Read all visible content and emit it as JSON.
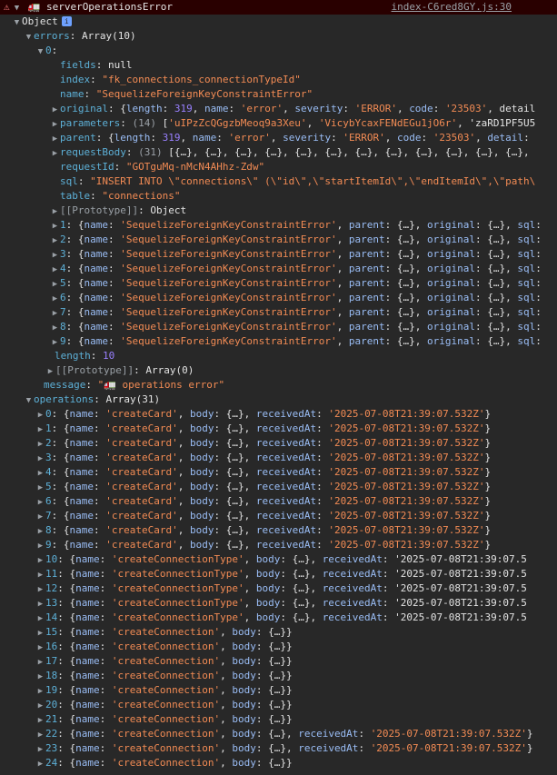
{
  "header": {
    "warn_icon": "⚠",
    "title": "serverOperationsError",
    "link": "index-C6red8GY.js:30"
  },
  "object_label": "Object",
  "errors_label": "errors",
  "errors_type": "Array(10)",
  "error0": {
    "key": "0",
    "fields": {
      "key": "fields",
      "value": "null"
    },
    "index": {
      "key": "index",
      "value": "\"fk_connections_connectionTypeId\""
    },
    "name": {
      "key": "name",
      "value": "\"SequelizeForeignKeyConstraintError\""
    },
    "original": {
      "key": "original",
      "value": "{length: 319, name: 'error', severity: 'ERROR', code: '23503', detail"
    },
    "parameters": {
      "key": "parameters",
      "value": "(14) ['uIPzZcQGgzbMeoq9a3Xeu', 'VicybYcaxFENdEGu1jO6r', 'zaRD1PF5U5"
    },
    "parent": {
      "key": "parent",
      "value": "{length: 319, name: 'error', severity: 'ERROR', code: '23503', detail:"
    },
    "requestBody": {
      "key": "requestBody",
      "value": "(31) [{…}, {…}, {…}, {…}, {…}, {…}, {…}, {…}, {…}, {…}, {…}, {…},"
    },
    "requestId": {
      "key": "requestId",
      "value": "\"GOTguMq-nMcN4AHhz-Zdw\""
    },
    "sql": {
      "key": "sql",
      "value": "\"INSERT INTO \\\"connections\\\" (\\\"id\\\",\\\"startItemId\\\",\\\"endItemId\\\",\\\"path\\"
    },
    "table": {
      "key": "table",
      "value": "\"connections\""
    },
    "prototype": {
      "key": "[[Prototype]]",
      "value": "Object"
    }
  },
  "error_rows": [
    "{name: 'SequelizeForeignKeyConstraintError', parent: {…}, original: {…}, sql:",
    "{name: 'SequelizeForeignKeyConstraintError', parent: {…}, original: {…}, sql:",
    "{name: 'SequelizeForeignKeyConstraintError', parent: {…}, original: {…}, sql:",
    "{name: 'SequelizeForeignKeyConstraintError', parent: {…}, original: {…}, sql:",
    "{name: 'SequelizeForeignKeyConstraintError', parent: {…}, original: {…}, sql:",
    "{name: 'SequelizeForeignKeyConstraintError', parent: {…}, original: {…}, sql:",
    "{name: 'SequelizeForeignKeyConstraintError', parent: {…}, original: {…}, sql:",
    "{name: 'SequelizeForeignKeyConstraintError', parent: {…}, original: {…}, sql:",
    "{name: 'SequelizeForeignKeyConstraintError', parent: {…}, original: {…}, sql:"
  ],
  "errors_length": {
    "key": "length",
    "value": "10"
  },
  "errors_prototype": {
    "key": "[[Prototype]]",
    "value": "Array(0)"
  },
  "message": {
    "key": "message",
    "value": "\"🚛 operations error\""
  },
  "operations_label": "operations",
  "operations_type": "Array(31)",
  "operations_rows": [
    "{name: 'createCard', body: {…}, receivedAt: '2025-07-08T21:39:07.532Z'}",
    "{name: 'createCard', body: {…}, receivedAt: '2025-07-08T21:39:07.532Z'}",
    "{name: 'createCard', body: {…}, receivedAt: '2025-07-08T21:39:07.532Z'}",
    "{name: 'createCard', body: {…}, receivedAt: '2025-07-08T21:39:07.532Z'}",
    "{name: 'createCard', body: {…}, receivedAt: '2025-07-08T21:39:07.532Z'}",
    "{name: 'createCard', body: {…}, receivedAt: '2025-07-08T21:39:07.532Z'}",
    "{name: 'createCard', body: {…}, receivedAt: '2025-07-08T21:39:07.532Z'}",
    "{name: 'createCard', body: {…}, receivedAt: '2025-07-08T21:39:07.532Z'}",
    "{name: 'createCard', body: {…}, receivedAt: '2025-07-08T21:39:07.532Z'}",
    "{name: 'createCard', body: {…}, receivedAt: '2025-07-08T21:39:07.532Z'}",
    "{name: 'createConnectionType', body: {…}, receivedAt: '2025-07-08T21:39:07.5",
    "{name: 'createConnectionType', body: {…}, receivedAt: '2025-07-08T21:39:07.5",
    "{name: 'createConnectionType', body: {…}, receivedAt: '2025-07-08T21:39:07.5",
    "{name: 'createConnectionType', body: {…}, receivedAt: '2025-07-08T21:39:07.5",
    "{name: 'createConnectionType', body: {…}, receivedAt: '2025-07-08T21:39:07.5",
    "{name: 'createConnection', body: {…}}",
    "{name: 'createConnection', body: {…}}",
    "{name: 'createConnection', body: {…}}",
    "{name: 'createConnection', body: {…}}",
    "{name: 'createConnection', body: {…}}",
    "{name: 'createConnection', body: {…}}",
    "{name: 'createConnection', body: {…}}",
    "{name: 'createConnection', body: {…}, receivedAt: '2025-07-08T21:39:07.532Z'}",
    "{name: 'createConnection', body: {…}, receivedAt: '2025-07-08T21:39:07.532Z'}",
    "{name: 'createConnection', body: {…}}"
  ]
}
